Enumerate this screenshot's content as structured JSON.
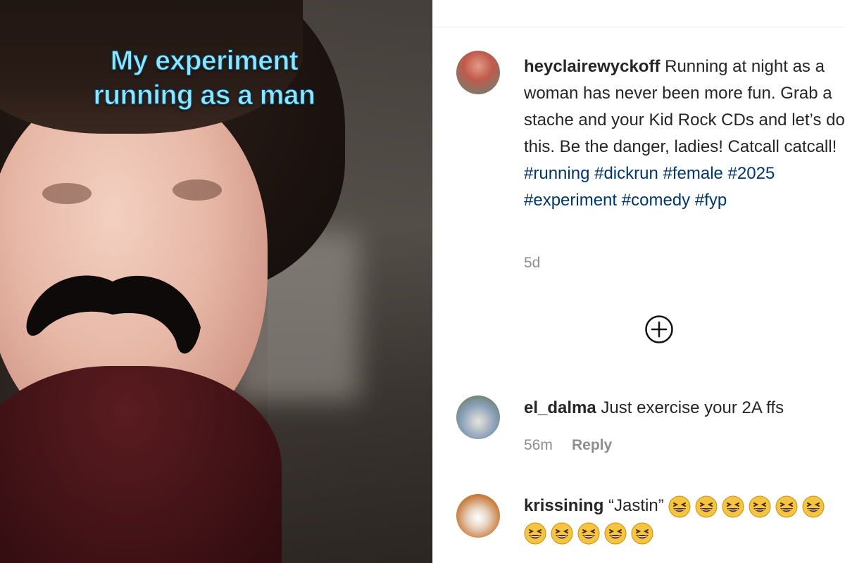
{
  "video": {
    "caption_line1": "My experiment",
    "caption_line2": "running as a man"
  },
  "post": {
    "username": "heyclairewyckoff",
    "text": "Running at night as a woman has never been more fun. Grab a stache and your Kid Rock CDs and let’s do this. Be the danger, ladies! Catcall catcall!",
    "hashtags": [
      "#running",
      "#dickrun",
      "#female",
      "#2025",
      "#experiment",
      "#comedy",
      "#fyp"
    ],
    "age": "5d"
  },
  "load_more": {
    "icon": "plus-circle-icon"
  },
  "comments": [
    {
      "username": "el_dalma",
      "text": "Just exercise your 2A ffs",
      "age": "56m",
      "reply_label": "Reply"
    },
    {
      "username": "krissining",
      "text": "“Jastin”",
      "emoji_count": 11,
      "emoji": "grinning-squinting-face"
    }
  ],
  "colors": {
    "hashtag": "#00376b",
    "caption": "#8fe4ff",
    "meta": "#8e8e8e"
  }
}
